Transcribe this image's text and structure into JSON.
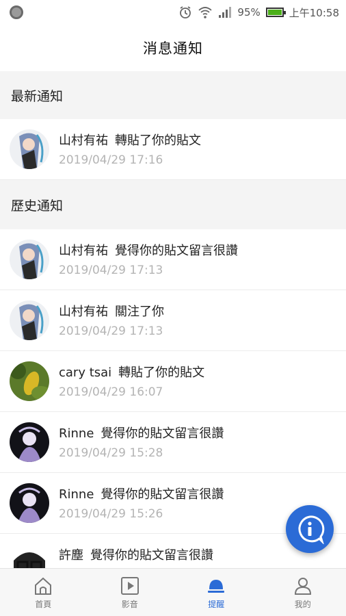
{
  "status_bar": {
    "battery_percent": "95%",
    "time": "上午10:58"
  },
  "header": {
    "title": "消息通知"
  },
  "sections": {
    "latest": "最新通知",
    "history": "歷史通知"
  },
  "latest_items": [
    {
      "actor": "山村有祐",
      "action": "轉貼了你的貼文",
      "time": "2019/04/29 17:16",
      "avatar": "anime-girl-avatar"
    }
  ],
  "history_items": [
    {
      "actor": "山村有祐",
      "action": "覺得你的貼文留言很讚",
      "time": "2019/04/29 17:13",
      "avatar": "anime-girl-avatar"
    },
    {
      "actor": "山村有祐",
      "action": "關注了你",
      "time": "2019/04/29 17:13",
      "avatar": "anime-girl-avatar"
    },
    {
      "actor": "cary tsai",
      "action": "轉貼了你的貼文",
      "time": "2019/04/29 16:07",
      "avatar": "fruit-photo-avatar"
    },
    {
      "actor": "Rinne",
      "action": "覺得你的貼文留言很讚",
      "time": "2019/04/29 15:28",
      "avatar": "anime-dark-avatar"
    },
    {
      "actor": "Rinne",
      "action": "覺得你的貼文留言很讚",
      "time": "2019/04/29 15:26",
      "avatar": "anime-dark-avatar"
    },
    {
      "actor": "許塵",
      "action": "覺得你的貼文留言很讚",
      "time": "",
      "avatar": "glasses-face-avatar"
    }
  ],
  "bottom_nav": [
    {
      "label": "首頁",
      "icon": "home-icon"
    },
    {
      "label": "影音",
      "icon": "play-icon"
    },
    {
      "label": "提醒",
      "icon": "bell-icon",
      "active": true
    },
    {
      "label": "我的",
      "icon": "person-icon"
    }
  ],
  "colors": {
    "accent": "#2b6bd6",
    "section_bg": "#f4f4f4",
    "time_text": "#b4b4b4"
  }
}
